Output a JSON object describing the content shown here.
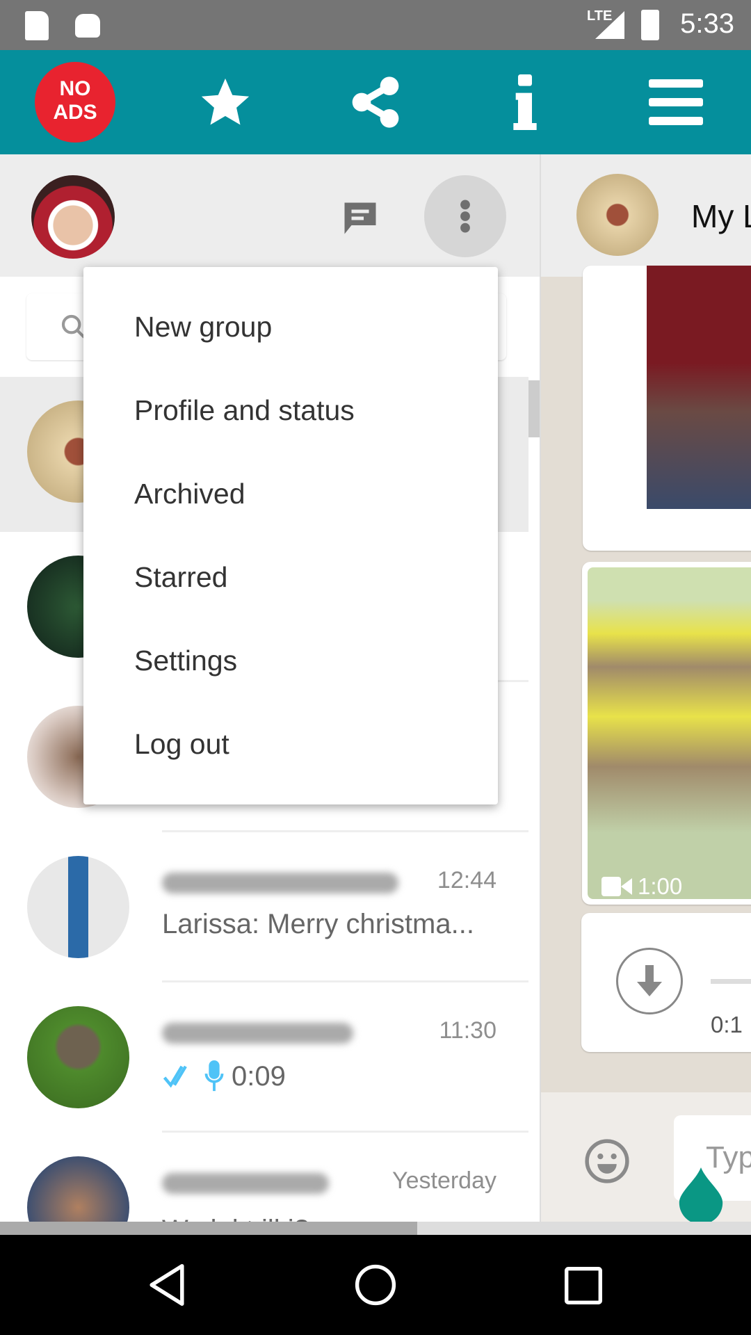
{
  "status_bar": {
    "time": "5:33",
    "network": "LTE",
    "icons": [
      "sd-card-icon",
      "android-icon",
      "signal-icon",
      "battery-charging-icon"
    ]
  },
  "toolbar": {
    "no_ads_top": "NO",
    "no_ads_bottom": "ADS",
    "icons": [
      "star-icon",
      "share-icon",
      "info-icon",
      "menu-icon"
    ],
    "color": "#058f9c"
  },
  "left_header": {
    "icons": [
      "new-chat-icon",
      "more-vert-icon"
    ]
  },
  "search": {
    "icon": "search-icon"
  },
  "menu": {
    "items": [
      "New group",
      "Profile and status",
      "Archived",
      "Starred",
      "Settings",
      "Log out"
    ]
  },
  "chats": [
    {
      "time": "",
      "message": ""
    },
    {
      "time": "",
      "message": ""
    },
    {
      "time": "",
      "message": ""
    },
    {
      "time": "12:44",
      "message": "Larissa: Merry christma..."
    },
    {
      "time": "11:30",
      "message": "0:09"
    },
    {
      "time": "Yesterday",
      "message": "Wa lal  t  ill  i?"
    }
  ],
  "conversation": {
    "title": "My L",
    "video_duration": "1:00",
    "voice_duration": "0:1",
    "input_placeholder": "Typ"
  },
  "colors": {
    "teal": "#058f9c",
    "read_ticks": "#4fc3f7",
    "no_ads": "#e8232f"
  }
}
